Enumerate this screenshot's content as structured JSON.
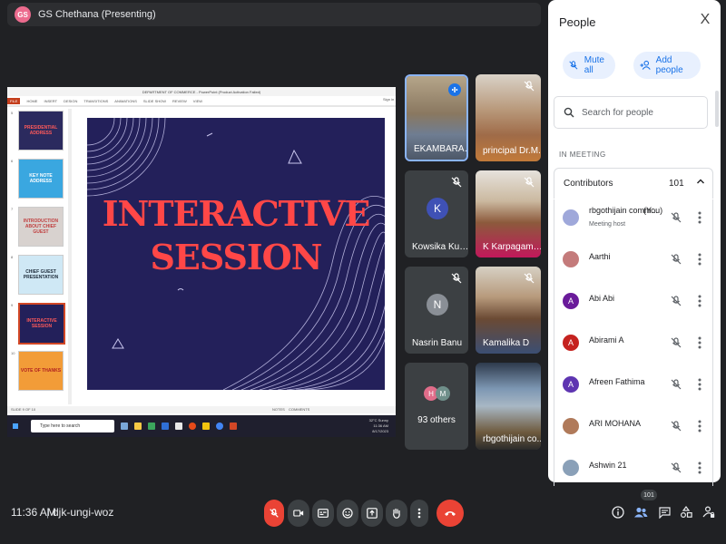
{
  "presenter": {
    "initials": "GS",
    "label": "GS Chethana (Presenting)"
  },
  "presentation": {
    "window_title": "DEPARTMENT OF COMMERCE - PowerPoint (Product Activation Failed)",
    "ribbon_tabs": [
      "FILE",
      "HOME",
      "INSERT",
      "DESIGN",
      "TRANSITIONS",
      "ANIMATIONS",
      "SLIDE SHOW",
      "REVIEW",
      "VIEW"
    ],
    "sign_in": "Sign in",
    "thumbnails": [
      {
        "num": "5",
        "text": "PRESIDENTIAL ADDRESS"
      },
      {
        "num": "6",
        "text": "KEY NOTE ADDRESS"
      },
      {
        "num": "7",
        "text": "INTRODUCTION ABOUT CHIEF GUEST"
      },
      {
        "num": "8",
        "text": "CHIEF GUEST PRESENTATION"
      },
      {
        "num": "9",
        "text": "INTERACTIVE SESSION"
      },
      {
        "num": "10",
        "text": "VOTE OF THANKS"
      }
    ],
    "slide_title_line1": "INTERACTIVE",
    "slide_title_line2": "SESSION",
    "status_left": "SLIDE 9 OF 10",
    "status_notes": "NOTES",
    "status_comments": "COMMENTS",
    "taskbar_search": "Type here to search",
    "tray_weather": "32°C Sunny",
    "tray_time": "11:36 AM",
    "tray_date": "8/17/2023"
  },
  "tiles": [
    {
      "name": "EKAMBARAM ..."
    },
    {
      "name": "principal Dr.M..."
    },
    {
      "name": "Kowsika Kuma...",
      "initial": "K"
    },
    {
      "name": "K Karpagambi..."
    },
    {
      "name": "Nasrin Banu",
      "initial": "N"
    },
    {
      "name": "Kamalika D"
    },
    {
      "name": "93 others",
      "initials": [
        "H",
        "M"
      ]
    },
    {
      "name": "rbgothijain co..."
    }
  ],
  "panel": {
    "title": "People",
    "close": "X",
    "mute_all": "Mute all",
    "add_people": "Add people",
    "search_placeholder": "Search for people",
    "section_label": "IN MEETING",
    "group_label": "Contributors",
    "group_count": "101",
    "people": [
      {
        "name": "rbgothijain comm...",
        "you": "(You)",
        "sub": "Meeting host",
        "color": "#9fa8da"
      },
      {
        "name": "Aarthi",
        "color": "#c47b7b"
      },
      {
        "name": "Abi Abi",
        "initial": "A",
        "color": "#6a1b9a"
      },
      {
        "name": "Abirami A",
        "initial": "A",
        "color": "#c5221f"
      },
      {
        "name": "Afreen Fathima",
        "initial": "A",
        "color": "#5e35b1"
      },
      {
        "name": "ARI MOHANA",
        "color": "#b07a5a"
      },
      {
        "name": "Ashwin 21",
        "color": "#8aa0b8"
      }
    ]
  },
  "bottom": {
    "time": "11:36 AM",
    "separator": "|",
    "meeting_code": "djk-ungi-woz",
    "participants_badge": "101"
  },
  "colors": {
    "accent": "#1a73e8",
    "danger": "#ea4335",
    "tile_bg": "#3c4043",
    "speaking": "#1a73e8"
  }
}
